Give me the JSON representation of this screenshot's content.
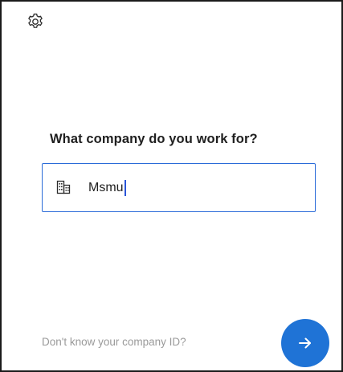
{
  "colors": {
    "accent": "#1f73d6",
    "input_border": "#2a6bd8",
    "text_primary": "#1f1f1f",
    "text_muted": "#9a9a9a",
    "frame_border": "#1a1a1a"
  },
  "toolbar": {
    "settings_icon": "gear-icon"
  },
  "main": {
    "question": "What company do you work for?",
    "company_field": {
      "icon": "building-icon",
      "value": "Msmu"
    }
  },
  "footer": {
    "help_link": "Don't know your company ID?",
    "next_icon": "arrow-right-icon"
  }
}
